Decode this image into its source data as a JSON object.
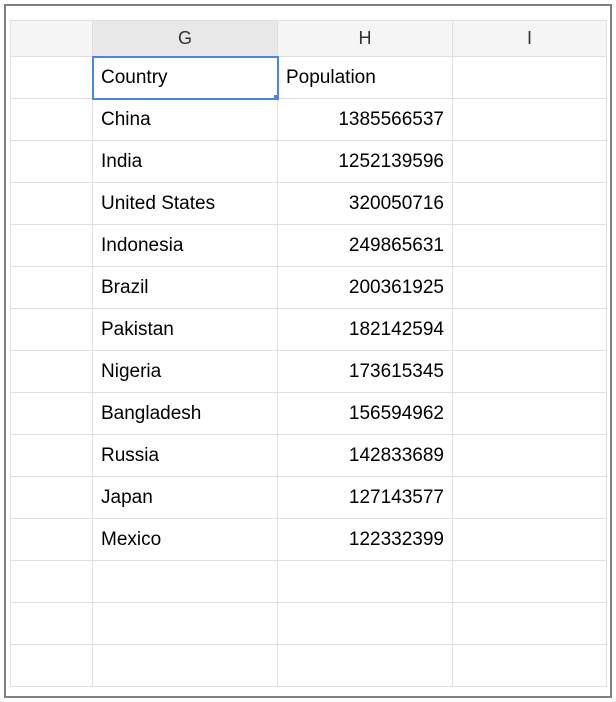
{
  "columns": [
    "G",
    "H",
    "I"
  ],
  "active_cell": {
    "col": 0,
    "row": 0
  },
  "rows": [
    {
      "g": "Country",
      "h": "Population",
      "h_align": "left"
    },
    {
      "g": "China",
      "h": "1385566537",
      "h_align": "right"
    },
    {
      "g": "India",
      "h": "1252139596",
      "h_align": "right"
    },
    {
      "g": "United States",
      "h": "320050716",
      "h_align": "right"
    },
    {
      "g": "Indonesia",
      "h": "249865631",
      "h_align": "right"
    },
    {
      "g": "Brazil",
      "h": "200361925",
      "h_align": "right"
    },
    {
      "g": "Pakistan",
      "h": "182142594",
      "h_align": "right"
    },
    {
      "g": "Nigeria",
      "h": "173615345",
      "h_align": "right"
    },
    {
      "g": "Bangladesh",
      "h": "156594962",
      "h_align": "right"
    },
    {
      "g": "Russia",
      "h": "142833689",
      "h_align": "right"
    },
    {
      "g": "Japan",
      "h": "127143577",
      "h_align": "right"
    },
    {
      "g": "Mexico",
      "h": "122332399",
      "h_align": "right"
    },
    {
      "g": "",
      "h": "",
      "h_align": "left"
    },
    {
      "g": "",
      "h": "",
      "h_align": "left"
    },
    {
      "g": "",
      "h": "",
      "h_align": "left"
    }
  ],
  "chart_data": {
    "type": "table",
    "columns": [
      "Country",
      "Population"
    ],
    "data": [
      [
        "China",
        1385566537
      ],
      [
        "India",
        1252139596
      ],
      [
        "United States",
        320050716
      ],
      [
        "Indonesia",
        249865631
      ],
      [
        "Brazil",
        200361925
      ],
      [
        "Pakistan",
        182142594
      ],
      [
        "Nigeria",
        173615345
      ],
      [
        "Bangladesh",
        156594962
      ],
      [
        "Russia",
        142833689
      ],
      [
        "Japan",
        127143577
      ],
      [
        "Mexico",
        122332399
      ]
    ]
  }
}
